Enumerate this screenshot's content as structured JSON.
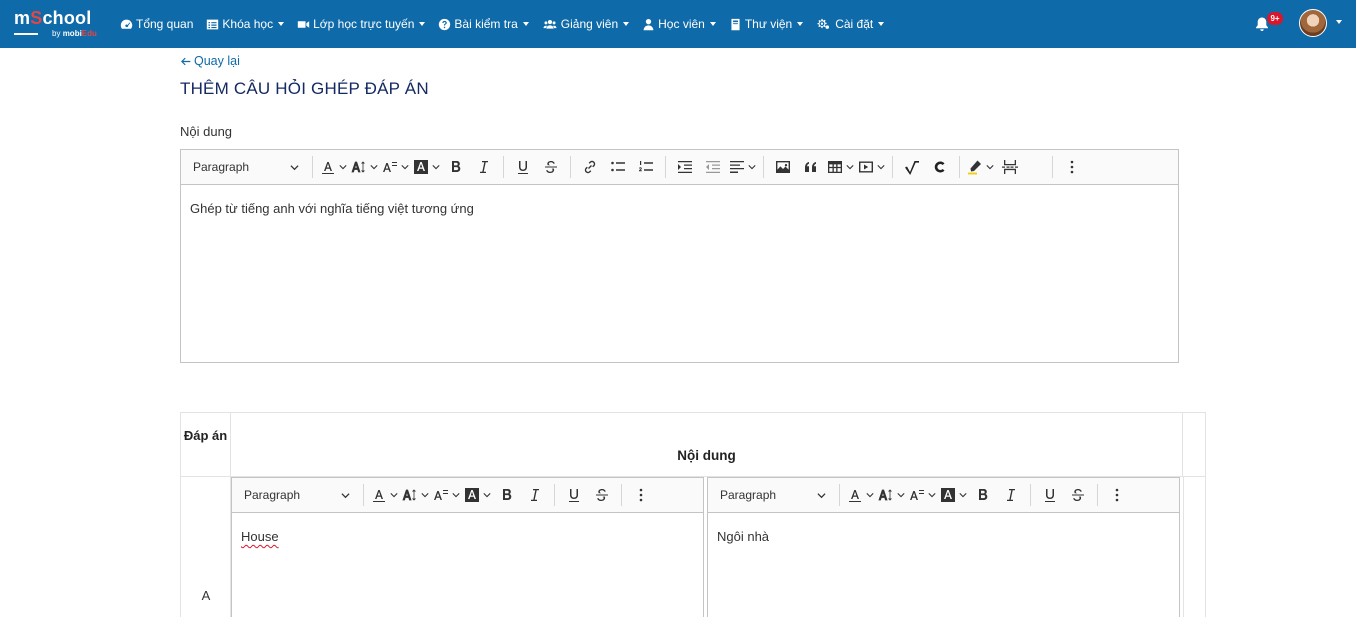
{
  "navbar": {
    "logo_main_a": "m",
    "logo_main_dot": "S",
    "logo_main_b": "chool",
    "logo_sub_by": "by",
    "logo_sub_brand_a": "mobi",
    "logo_sub_brand_b": "Edu",
    "menu": [
      {
        "label": "Tổng quan",
        "icon": "dashboard-icon",
        "dropdown": false
      },
      {
        "label": "Khóa học",
        "icon": "list-icon",
        "dropdown": true
      },
      {
        "label": "Lớp học trực tuyến",
        "icon": "video-icon",
        "dropdown": true
      },
      {
        "label": "Bài kiểm tra",
        "icon": "question-icon",
        "dropdown": true
      },
      {
        "label": "Giảng viên",
        "icon": "users-icon",
        "dropdown": true
      },
      {
        "label": "Học viên",
        "icon": "user-icon",
        "dropdown": true
      },
      {
        "label": "Thư viện",
        "icon": "book-icon",
        "dropdown": true
      },
      {
        "label": "Cài đặt",
        "icon": "gears-icon",
        "dropdown": true
      }
    ],
    "notification_badge": "9+"
  },
  "page": {
    "back_label": "Quay lại",
    "title": "THÊM CÂU HỎI GHÉP ĐÁP ÁN",
    "content_label": "Nội dung"
  },
  "editor_main": {
    "format_select": "Paragraph",
    "body_text": "Ghép từ tiếng anh với nghĩa tiếng việt tương ứng"
  },
  "answers": {
    "header_answer": "Đáp án",
    "header_content": "Nội dung",
    "rows": [
      {
        "label": "A",
        "left_format": "Paragraph",
        "left_text": "House",
        "right_format": "Paragraph",
        "right_text": "Ngôi nhà"
      }
    ]
  },
  "colors": {
    "navbar_bg": "#0e6aa8",
    "title_color": "#152a63",
    "link_color": "#0e6aa8",
    "badge_bg": "#d9162a"
  }
}
